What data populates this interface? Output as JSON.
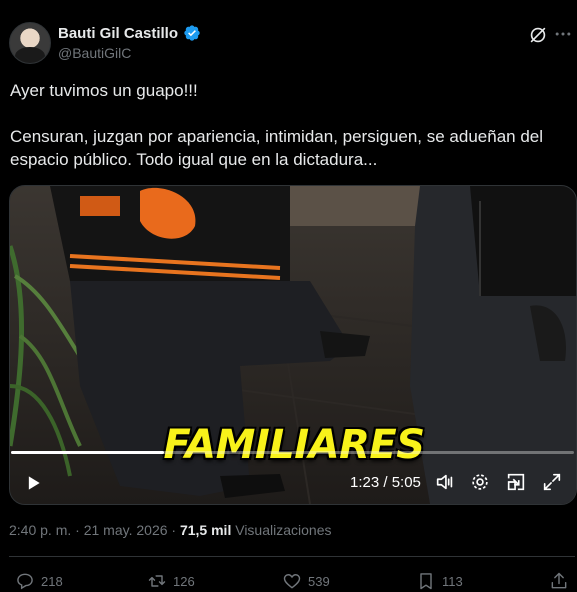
{
  "author": {
    "display_name": "Bauti Gil Castillo",
    "handle": "@BautiGilC"
  },
  "tweet": {
    "line1": "Ayer tuvimos un guapo!!!",
    "line2": "Censuran, juzgan por apariencia, intimidan, persiguen, se adueñan del espacio público. Todo igual que en la dictadura..."
  },
  "video": {
    "overlay_caption": "FAMILIARES",
    "time": "1:23 / 5:05",
    "progress": 0.272
  },
  "meta": {
    "time": "2:40 p. m.",
    "separator1": " · ",
    "date": "21 may. 2026",
    "separator2": " · ",
    "views_count": "71,5 mil",
    "views_label": " Visualizaciones"
  },
  "actions": {
    "replies": "218",
    "reposts": "126",
    "likes": "539",
    "bookmarks": "113"
  },
  "icons": [
    "verified-icon",
    "grok-icon",
    "more-icon",
    "play-icon",
    "volume-icon",
    "settings-icon",
    "pip-icon",
    "fullscreen-icon",
    "reply-icon",
    "repost-icon",
    "like-icon",
    "bookmark-icon",
    "share-icon"
  ],
  "colors": {
    "verified": "#1d9bf0",
    "overlay_text": "#f8f21a",
    "muted": "#71767b"
  }
}
